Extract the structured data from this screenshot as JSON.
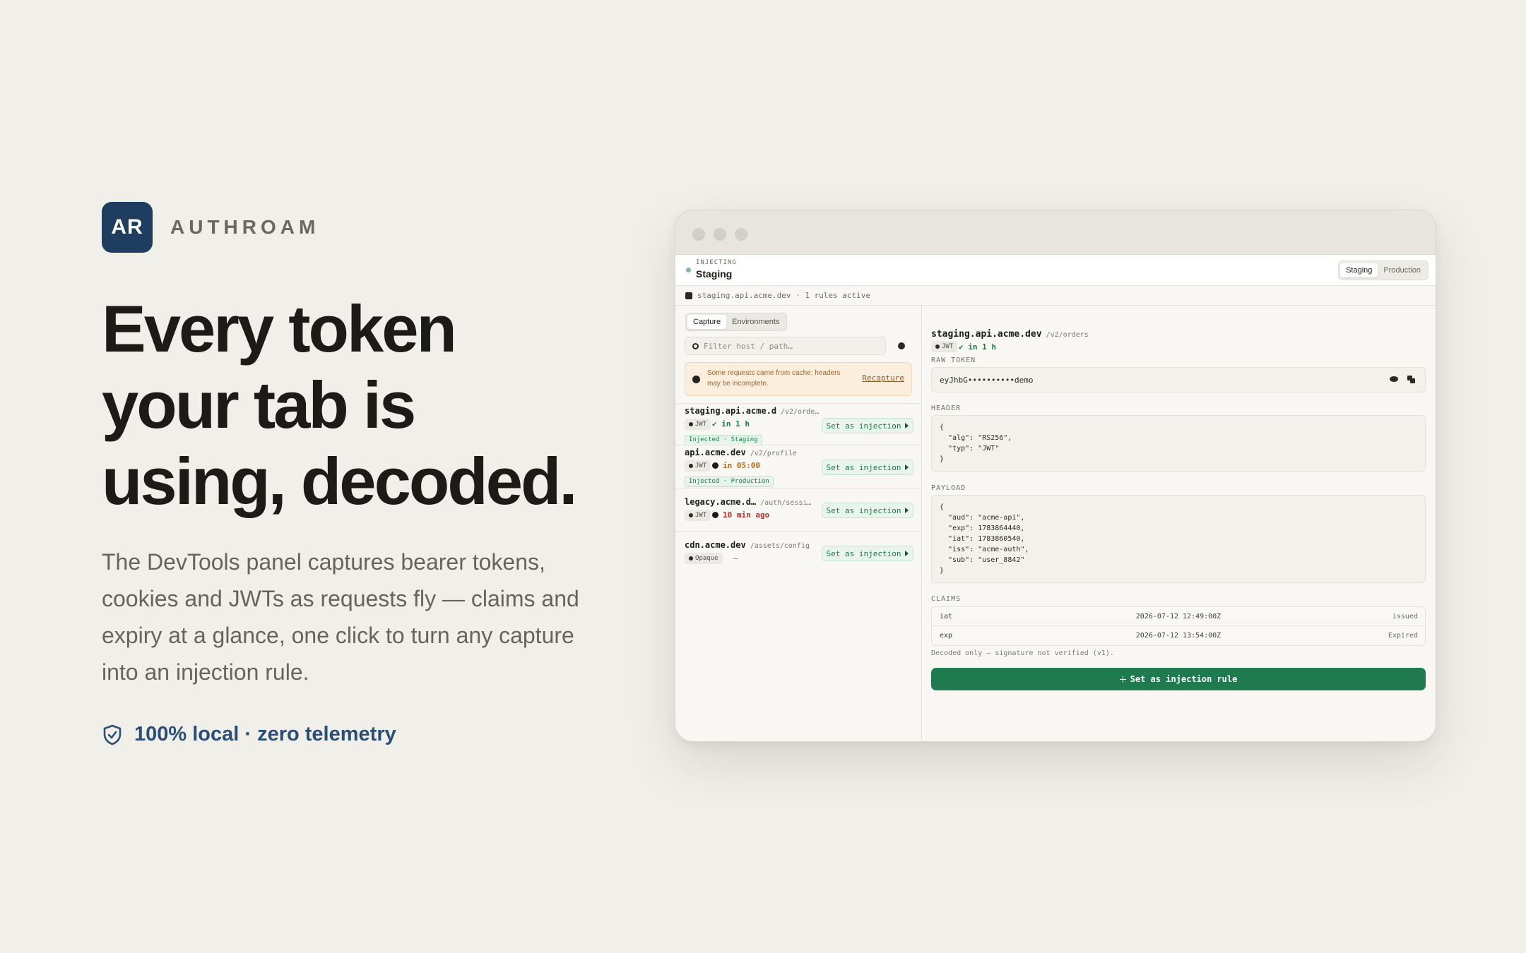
{
  "brand": {
    "logo": "AR",
    "name": "AUTHROAM"
  },
  "hero": {
    "headline_lines": [
      "Every token",
      "your tab is",
      "using, decoded."
    ],
    "subtitle": "The DevTools panel captures bearer tokens, cookies and JWTs as requests fly — claims and expiry at a glance, one click to turn any capture into an injection rule.",
    "privacy": "100% local · zero telemetry",
    "privacy_icon": "shield-check-icon"
  },
  "panel": {
    "env": {
      "kicker": "INJECTING",
      "name": "Staging",
      "options": [
        "Staging",
        "Production"
      ],
      "selected": "Staging"
    },
    "host_bar": "staging.api.acme.dev · 1 rules active",
    "tabs": [
      "Capture",
      "Environments"
    ],
    "active_tab": "Capture",
    "search_placeholder": "Filter host / path…",
    "warning": {
      "text": "Some requests came from cache; headers may be incomplete.",
      "action": "Recapture"
    },
    "captures": [
      {
        "host": "staging.api.acme.d",
        "path": "/v2/orde…",
        "type": "JWT",
        "status": "✔ in 1 h",
        "status_color": "#1d7a4b",
        "injected": "Injected · Staging",
        "action": "Set as injection"
      },
      {
        "host": "api.acme.dev",
        "path": "/v2/profile",
        "type": "JWT",
        "status": "in 05:00",
        "status_color": "#b06a1a",
        "injected": "Injected · Production",
        "action": "Set as injection"
      },
      {
        "host": "legacy.acme.d…",
        "path": "/auth/sessi…",
        "type": "JWT",
        "status": "10 min ago",
        "status_color": "#b3302a",
        "injected": "",
        "action": "Set as injection"
      },
      {
        "host": "cdn.acme.dev",
        "path": "/assets/config",
        "type": "Opaque",
        "status": "–",
        "status_color": "#6e6c64",
        "injected": "",
        "action": "Set as injection"
      }
    ],
    "detail": {
      "host": "staging.api.acme.dev",
      "path": "/v2/orders",
      "type": "JWT",
      "expiry": "✔ in 1 h",
      "raw_token_label": "RAW TOKEN",
      "raw_token": "eyJhbG••••••••••demo",
      "header_label": "HEADER",
      "header_json": "{\n  \"alg\": \"RS256\",\n  \"typ\": \"JWT\"\n}",
      "payload_label": "PAYLOAD",
      "payload_json": "{\n  \"aud\": \"acme-api\",\n  \"exp\": 1783864440,\n  \"iat\": 1783860540,\n  \"iss\": \"acme-auth\",\n  \"sub\": \"user_8842\"\n}",
      "claims_label": "CLAIMS",
      "claims": [
        {
          "key": "iat",
          "value": "2026-07-12 12:49:00Z",
          "status": "issued"
        },
        {
          "key": "exp",
          "value": "2026-07-12 13:54:00Z",
          "status": "Expired"
        }
      ],
      "note": "Decoded only — signature not verified (v1).",
      "cta": "Set as injection rule"
    }
  },
  "colors": {
    "accent": "#1f7a4f",
    "brand": "#1f3d5e",
    "background": "#f0efea"
  }
}
